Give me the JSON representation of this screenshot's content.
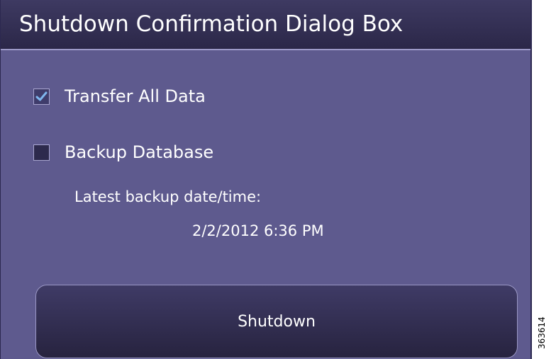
{
  "dialog": {
    "title": "Shutdown Confirmation Dialog Box"
  },
  "options": [
    {
      "label": "Transfer All Data",
      "checked": true
    },
    {
      "label": "Backup Database",
      "checked": false
    }
  ],
  "backup": {
    "label": "Latest backup date/time:",
    "value": "2/2/2012 6:36 PM"
  },
  "shutdown_button": {
    "label": "Shutdown"
  },
  "figure_id": "363614",
  "colors": {
    "dialog_background": "#5e5a8e",
    "titlebar": "#2b2748",
    "text": "#ffffff",
    "check_mark": "#7fb6ee"
  }
}
